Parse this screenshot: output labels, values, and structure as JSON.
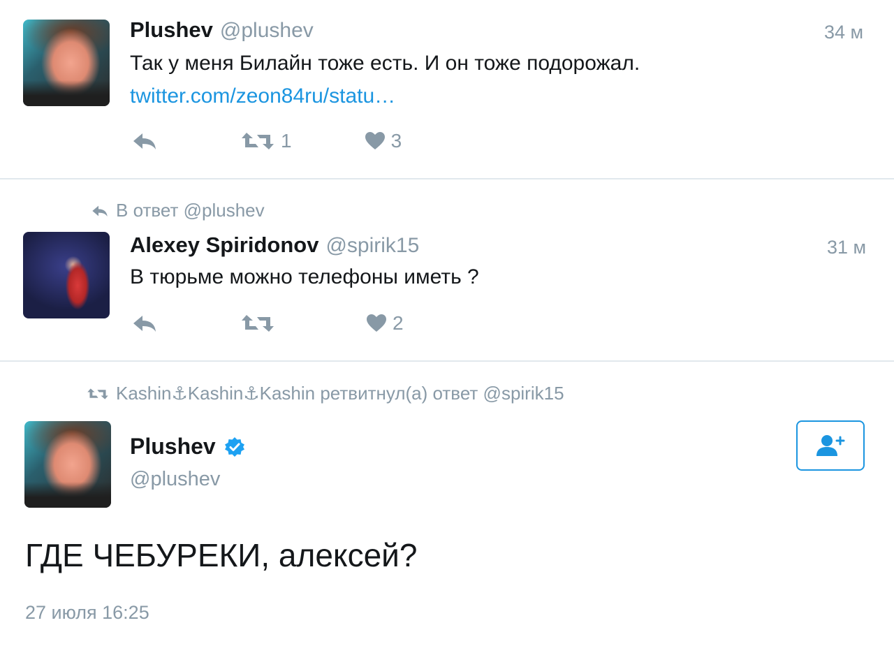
{
  "tweets": [
    {
      "name": "Plushev",
      "handle": "@plushev",
      "time": "34 м",
      "text": "Так у меня Билайн тоже есть. И он тоже подорожал.",
      "link": "twitter.com/zeon84ru/statu…",
      "retweets": "1",
      "likes": "3",
      "avatar_icon": "avatar-photo"
    },
    {
      "reply_context": "В ответ @plushev",
      "name": "Alexey Spiridonov",
      "handle": "@spirik15",
      "time": "31 м",
      "text": "В тюрьме можно телефоны иметь ?",
      "likes": "2",
      "avatar_icon": "avatar-photo"
    }
  ],
  "main_tweet": {
    "retweet_context": "Kashin⚓Kashin⚓Kashin ретвитнул(а) ответ @spirik15",
    "name": "Plushev",
    "handle": "@plushev",
    "text": "ГДЕ ЧЕБУРЕКИ, алексей?",
    "date": "27 июля 16:25",
    "verified_icon": "verified-badge-icon",
    "follow_icon": "follow-user-icon"
  },
  "colors": {
    "accent": "#1b95e0",
    "muted": "#8899a6",
    "text": "#14171a",
    "divider": "#e1e8ed"
  }
}
